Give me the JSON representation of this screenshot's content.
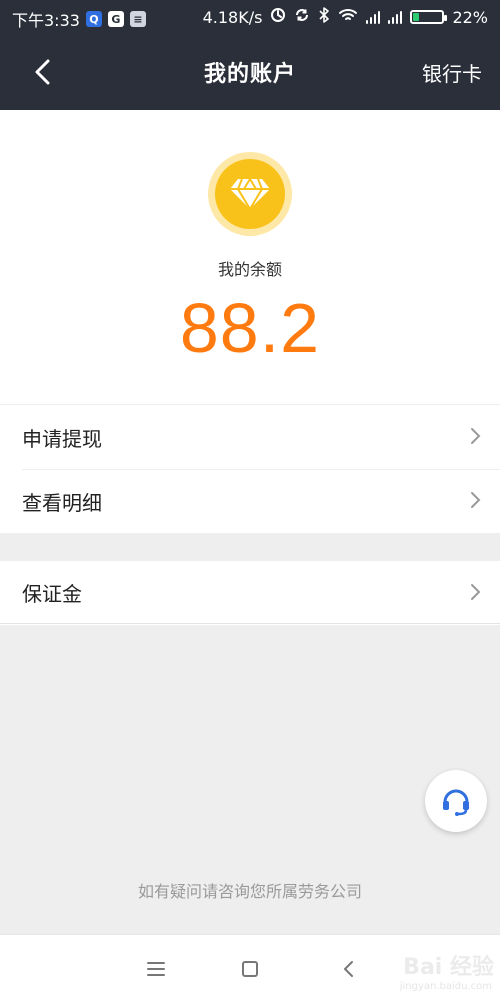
{
  "status_bar": {
    "time": "下午3:33",
    "network_speed": "4.18K/s",
    "battery_percent": "22%",
    "battery_level": 0.22,
    "icons": [
      "app-icon",
      "google-icon",
      "message-icon",
      "alarm-icon",
      "sync-icon",
      "bluetooth-icon",
      "wifi-icon",
      "signal-icon",
      "signal-icon",
      "battery-icon"
    ]
  },
  "navbar": {
    "title": "我的账户",
    "right_action": "银行卡"
  },
  "account": {
    "balance_label": "我的余额",
    "balance_value": "88.2"
  },
  "menu": {
    "items": [
      {
        "label": "申请提现"
      },
      {
        "label": "查看明细"
      }
    ],
    "deposit": {
      "label": "保证金"
    }
  },
  "footer": {
    "note": "如有疑问请咨询您所属劳务公司"
  },
  "watermark": {
    "brand": "Bai 经验",
    "url": "jingyan.baidu.com"
  },
  "colors": {
    "topbar": "#2b2f3a",
    "accent_orange": "#ff7a0f",
    "gold": "#f9c21a",
    "gold_light": "#fde8a7",
    "support_blue": "#2f6fe0"
  }
}
